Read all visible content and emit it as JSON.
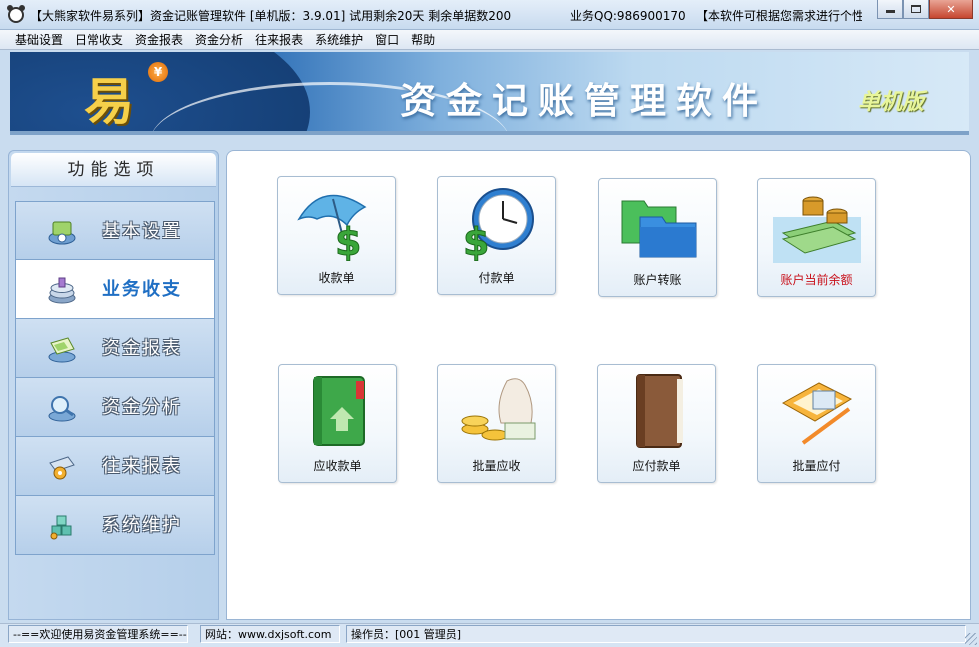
{
  "window": {
    "title": "【大熊家软件易系列】资金记账管理软件  [单机版：3.9.01]  试用剩余20天  剩余单据数200",
    "qq": "业务QQ:986900170",
    "notice": "【本软件可根据您需求进行个性化定制"
  },
  "menu": [
    "基础设置",
    "日常收支",
    "资金报表",
    "资金分析",
    "往来报表",
    "系统维护",
    "窗口",
    "帮助"
  ],
  "banner": {
    "logo": "易",
    "logo_badge": "¥",
    "title": "资金记账管理软件",
    "edition": "单机版"
  },
  "sidebar": {
    "header": "功能选项",
    "items": [
      {
        "label": "基本设置",
        "icon": "gear-disc-icon",
        "active": false
      },
      {
        "label": "业务收支",
        "icon": "stack-icon",
        "active": true
      },
      {
        "label": "资金报表",
        "icon": "report-icon",
        "active": false
      },
      {
        "label": "资金分析",
        "icon": "magnifier-icon",
        "active": false
      },
      {
        "label": "往来报表",
        "icon": "gear-board-icon",
        "active": false
      },
      {
        "label": "系统维护",
        "icon": "blocks-icon",
        "active": false
      }
    ]
  },
  "tiles": [
    {
      "label": "收款单",
      "icon": "umbrella-dollar-icon"
    },
    {
      "label": "付款单",
      "icon": "clock-dollar-icon"
    },
    {
      "label": "账户转账",
      "icon": "folders-icon"
    },
    {
      "label": "账户当前余额",
      "icon": "money-stack-icon",
      "highlight": true
    },
    {
      "label": "应收款单",
      "icon": "green-book-icon"
    },
    {
      "label": "批量应收",
      "icon": "coins-bag-icon"
    },
    {
      "label": "应付款单",
      "icon": "brown-book-icon"
    },
    {
      "label": "批量应付",
      "icon": "pen-document-icon"
    }
  ],
  "status": {
    "welcome": "--==欢迎使用易资金管理系统==--",
    "website": "网站：www.dxjsoft.com",
    "operator": "操作员：[001 管理员]"
  },
  "colors": {
    "banner_dark": "#1b4d8e",
    "active_nav_text": "#1f6fc4",
    "highlight_label": "#c8101a"
  }
}
